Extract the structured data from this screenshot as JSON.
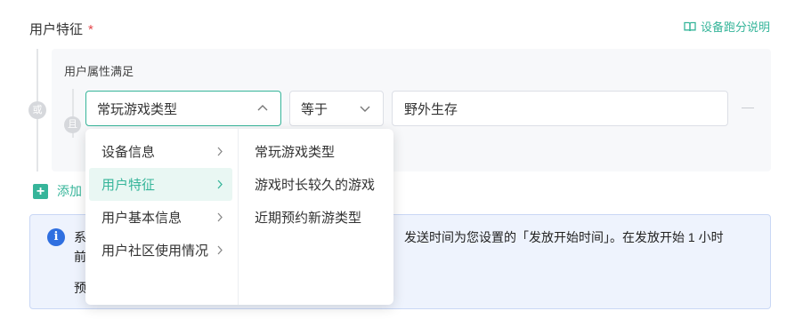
{
  "field": {
    "label": "用户特征",
    "required_mark": "*"
  },
  "help_link": {
    "label": "设备跑分说明"
  },
  "group": {
    "or_badge": "或",
    "and_badge": "且",
    "title": "用户属性满足"
  },
  "condition": {
    "attribute": "常玩游戏类型",
    "operator": "等于",
    "value": "野外生存"
  },
  "add_row": {
    "label": "添加"
  },
  "dropdown": {
    "categories": [
      {
        "label": "设备信息"
      },
      {
        "label": "用户特征"
      },
      {
        "label": "用户基本信息"
      },
      {
        "label": "用户社区使用情况"
      }
    ],
    "active_index": 1,
    "options": [
      {
        "label": "常玩游戏类型"
      },
      {
        "label": "游戏时长较久的游戏"
      },
      {
        "label": "近期预约新游类型"
      }
    ]
  },
  "notice": {
    "icon": "i",
    "line1_left": "系",
    "line1_right": "发送时间为您设置的「发放开始时间」。在发放开始 1 小时",
    "line2_left": "前",
    "line3_left": "预"
  },
  "colors": {
    "accent": "#36b59a",
    "info": "#2f6fe0",
    "required": "#e5484d"
  }
}
